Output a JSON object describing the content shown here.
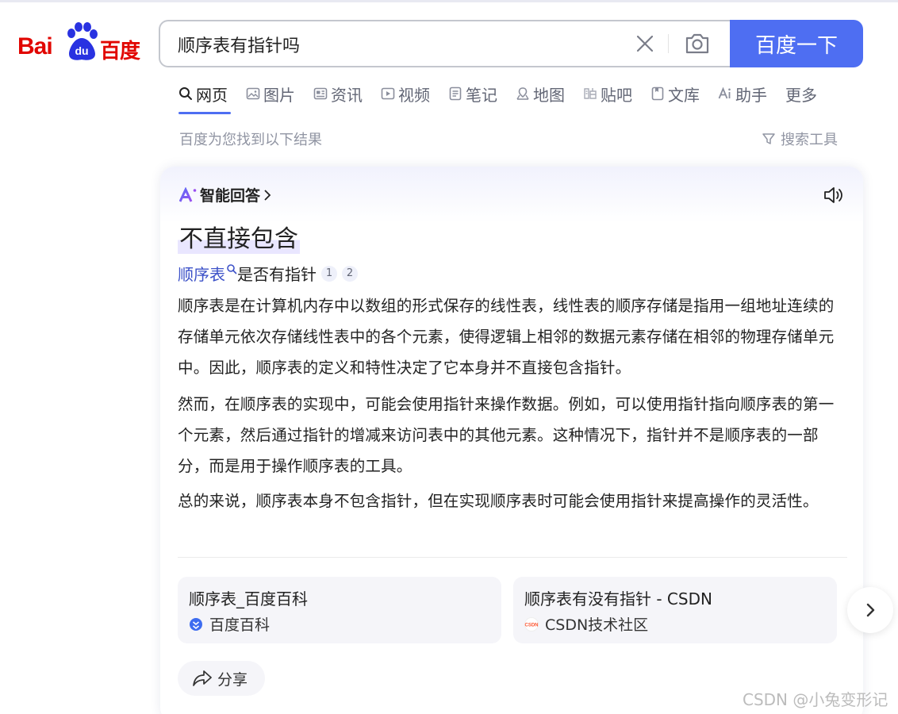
{
  "logo": {
    "latin": "Bai",
    "paw_text": "du",
    "chinese": "百度"
  },
  "search": {
    "query": "顺序表有指针吗",
    "button_label": "百度一下"
  },
  "tabs": [
    {
      "label": "网页",
      "icon": "search-icon",
      "active": true
    },
    {
      "label": "图片",
      "icon": "image-icon"
    },
    {
      "label": "资讯",
      "icon": "news-icon"
    },
    {
      "label": "视频",
      "icon": "video-icon"
    },
    {
      "label": "笔记",
      "icon": "note-icon"
    },
    {
      "label": "地图",
      "icon": "map-icon"
    },
    {
      "label": "贴吧",
      "icon": "tieba-icon"
    },
    {
      "label": "文库",
      "icon": "library-icon"
    },
    {
      "label": "助手",
      "icon": "ai-icon"
    },
    {
      "label": "更多"
    }
  ],
  "results_info": "百度为您找到以下结果",
  "search_tools": "搜索工具",
  "ai_answer": {
    "header_label": "智能回答",
    "title": "不直接包含",
    "subtitle_link": "顺序表",
    "subtitle_rest": "是否有指针",
    "citations": [
      "1",
      "2"
    ],
    "paragraphs": [
      "顺序表是在计算机内存中以数组的形式保存的线性表，线性表的顺序存储是指用一组地址连续的存储单元依次存储线性表中的各个元素，使得逻辑上相邻的数据元素存储在相邻的物理存储单元中。因此，顺序表的定义和特性决定了它本身并不直接包含指针。",
      "然而，在顺序表的实现中，可能会使用指针来操作数据。例如，可以使用指针指向顺序表的第一个元素，然后通过指针的增减来访问表中的其他元素。这种情况下，指针并不是顺序表的一部分，而是用于操作顺序表的工具。",
      "总的来说，顺序表本身不包含指针，但在实现顺序表时可能会使用指针来提高操作的灵活性。"
    ],
    "sources": [
      {
        "title": "顺序表_百度百科",
        "site": "百度百科"
      },
      {
        "title": "顺序表有没有指针 - CSDN",
        "site": "CSDN技术社区"
      }
    ],
    "share_label": "分享"
  },
  "watermark": "CSDN @小兔变形记",
  "colors": {
    "brand_red": "#e10601",
    "accent_blue": "#4e6ef2",
    "link_blue": "#3c51c8"
  }
}
